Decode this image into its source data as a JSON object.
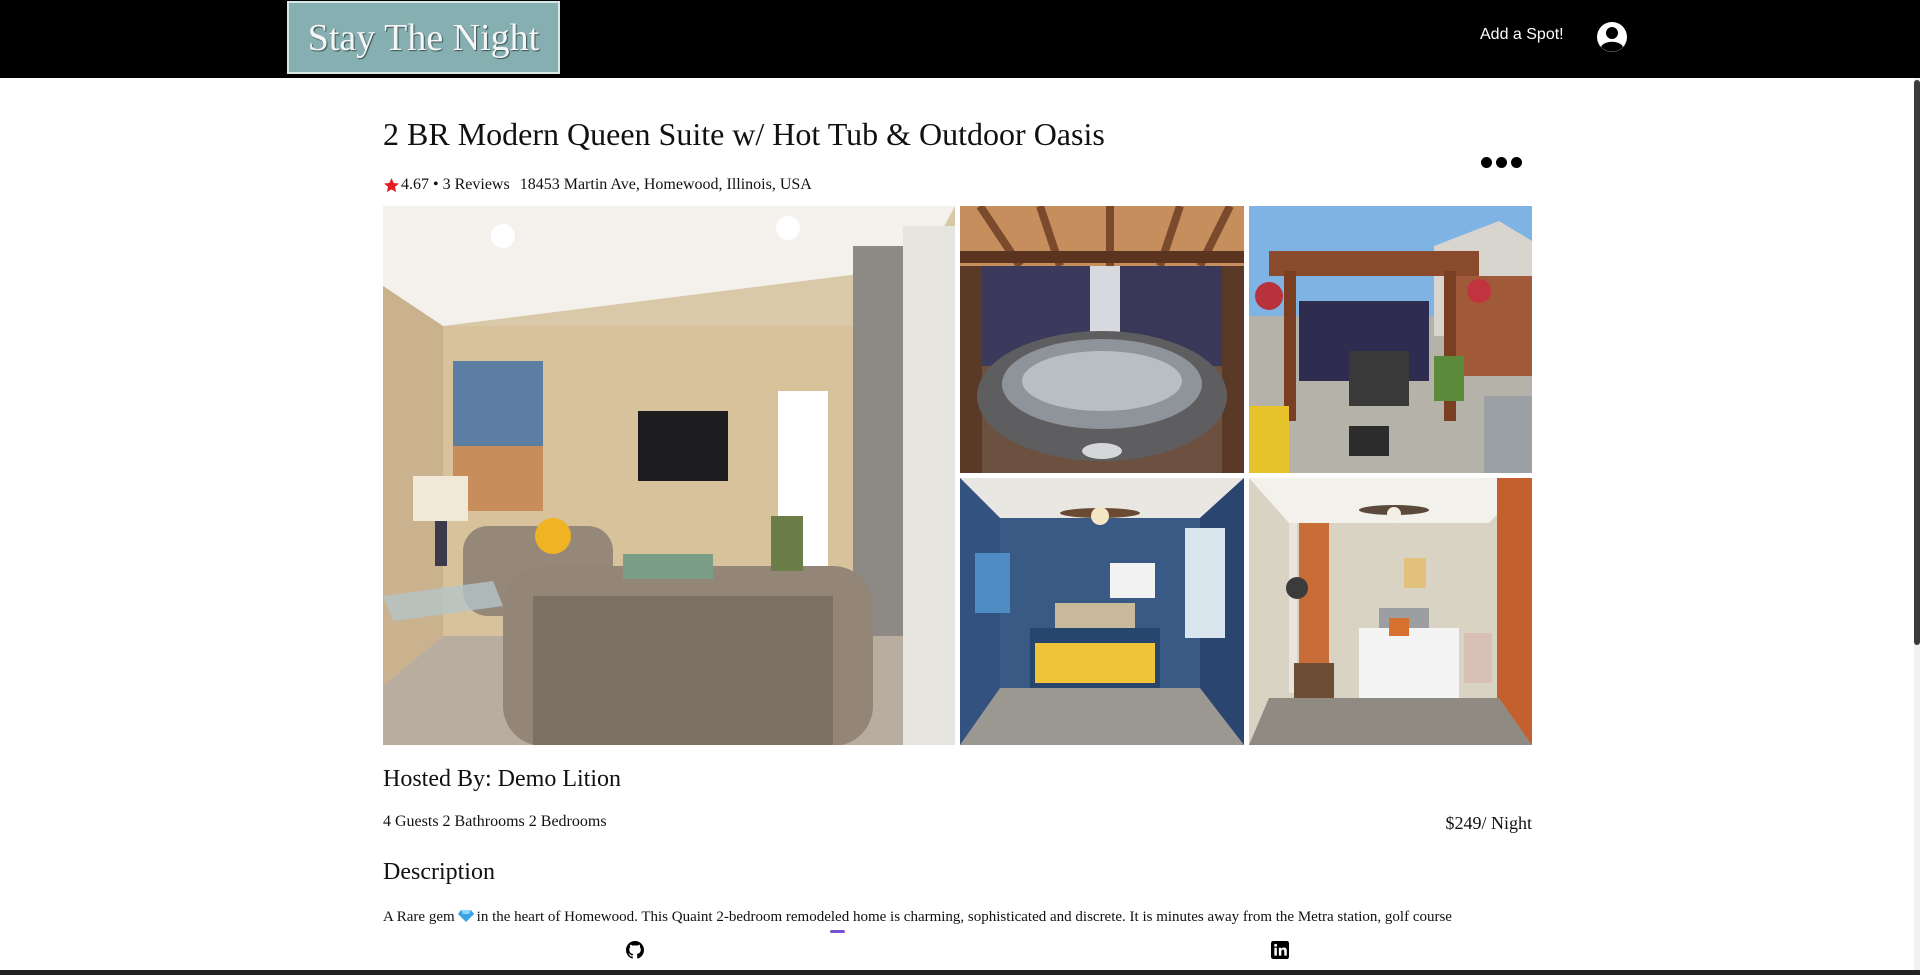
{
  "app": {
    "logo": "Stay The Night"
  },
  "nav": {
    "add_spot": "Add a Spot!",
    "profile_icon": "user-circle-icon"
  },
  "listing": {
    "title": "2 BR Modern Queen Suite w/ Hot Tub & Outdoor Oasis",
    "rating": "4.67",
    "separator": "•",
    "reviews": "3 Reviews",
    "address": "18453 Martin Ave, Homewood, Illinois, USA",
    "host": "Hosted By: Demo Lition",
    "specs": "4 Guests 2 Bathrooms 2 Bedrooms",
    "price": "$249/ Night",
    "description_heading": "Description",
    "description_pre": "A Rare gem",
    "description_post": "in the heart of Homewood. This Quaint 2-bedroom remodeled home is charming, sophisticated and discrete. It is minutes away from the Metra station, golf course"
  },
  "images": [
    {
      "name": "living-room-photo"
    },
    {
      "name": "hot-tub-photo"
    },
    {
      "name": "pergola-photo"
    },
    {
      "name": "blue-bedroom-photo"
    },
    {
      "name": "white-bedroom-photo"
    }
  ],
  "footer": {
    "icons": [
      "github-icon",
      "linkedin-icon"
    ]
  },
  "colors": {
    "logo_bg": "#86afb1",
    "star": "#e31b23",
    "topbar": "#000000"
  }
}
